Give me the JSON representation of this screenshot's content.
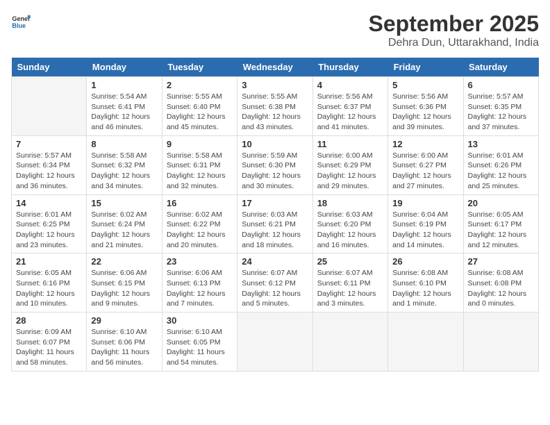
{
  "header": {
    "logo_general": "General",
    "logo_blue": "Blue",
    "month_year": "September 2025",
    "location": "Dehra Dun, Uttarakhand, India"
  },
  "days_of_week": [
    "Sunday",
    "Monday",
    "Tuesday",
    "Wednesday",
    "Thursday",
    "Friday",
    "Saturday"
  ],
  "weeks": [
    [
      {
        "day": "",
        "info": ""
      },
      {
        "day": "1",
        "info": "Sunrise: 5:54 AM\nSunset: 6:41 PM\nDaylight: 12 hours\nand 46 minutes."
      },
      {
        "day": "2",
        "info": "Sunrise: 5:55 AM\nSunset: 6:40 PM\nDaylight: 12 hours\nand 45 minutes."
      },
      {
        "day": "3",
        "info": "Sunrise: 5:55 AM\nSunset: 6:38 PM\nDaylight: 12 hours\nand 43 minutes."
      },
      {
        "day": "4",
        "info": "Sunrise: 5:56 AM\nSunset: 6:37 PM\nDaylight: 12 hours\nand 41 minutes."
      },
      {
        "day": "5",
        "info": "Sunrise: 5:56 AM\nSunset: 6:36 PM\nDaylight: 12 hours\nand 39 minutes."
      },
      {
        "day": "6",
        "info": "Sunrise: 5:57 AM\nSunset: 6:35 PM\nDaylight: 12 hours\nand 37 minutes."
      }
    ],
    [
      {
        "day": "7",
        "info": "Sunrise: 5:57 AM\nSunset: 6:34 PM\nDaylight: 12 hours\nand 36 minutes."
      },
      {
        "day": "8",
        "info": "Sunrise: 5:58 AM\nSunset: 6:32 PM\nDaylight: 12 hours\nand 34 minutes."
      },
      {
        "day": "9",
        "info": "Sunrise: 5:58 AM\nSunset: 6:31 PM\nDaylight: 12 hours\nand 32 minutes."
      },
      {
        "day": "10",
        "info": "Sunrise: 5:59 AM\nSunset: 6:30 PM\nDaylight: 12 hours\nand 30 minutes."
      },
      {
        "day": "11",
        "info": "Sunrise: 6:00 AM\nSunset: 6:29 PM\nDaylight: 12 hours\nand 29 minutes."
      },
      {
        "day": "12",
        "info": "Sunrise: 6:00 AM\nSunset: 6:27 PM\nDaylight: 12 hours\nand 27 minutes."
      },
      {
        "day": "13",
        "info": "Sunrise: 6:01 AM\nSunset: 6:26 PM\nDaylight: 12 hours\nand 25 minutes."
      }
    ],
    [
      {
        "day": "14",
        "info": "Sunrise: 6:01 AM\nSunset: 6:25 PM\nDaylight: 12 hours\nand 23 minutes."
      },
      {
        "day": "15",
        "info": "Sunrise: 6:02 AM\nSunset: 6:24 PM\nDaylight: 12 hours\nand 21 minutes."
      },
      {
        "day": "16",
        "info": "Sunrise: 6:02 AM\nSunset: 6:22 PM\nDaylight: 12 hours\nand 20 minutes."
      },
      {
        "day": "17",
        "info": "Sunrise: 6:03 AM\nSunset: 6:21 PM\nDaylight: 12 hours\nand 18 minutes."
      },
      {
        "day": "18",
        "info": "Sunrise: 6:03 AM\nSunset: 6:20 PM\nDaylight: 12 hours\nand 16 minutes."
      },
      {
        "day": "19",
        "info": "Sunrise: 6:04 AM\nSunset: 6:19 PM\nDaylight: 12 hours\nand 14 minutes."
      },
      {
        "day": "20",
        "info": "Sunrise: 6:05 AM\nSunset: 6:17 PM\nDaylight: 12 hours\nand 12 minutes."
      }
    ],
    [
      {
        "day": "21",
        "info": "Sunrise: 6:05 AM\nSunset: 6:16 PM\nDaylight: 12 hours\nand 10 minutes."
      },
      {
        "day": "22",
        "info": "Sunrise: 6:06 AM\nSunset: 6:15 PM\nDaylight: 12 hours\nand 9 minutes."
      },
      {
        "day": "23",
        "info": "Sunrise: 6:06 AM\nSunset: 6:13 PM\nDaylight: 12 hours\nand 7 minutes."
      },
      {
        "day": "24",
        "info": "Sunrise: 6:07 AM\nSunset: 6:12 PM\nDaylight: 12 hours\nand 5 minutes."
      },
      {
        "day": "25",
        "info": "Sunrise: 6:07 AM\nSunset: 6:11 PM\nDaylight: 12 hours\nand 3 minutes."
      },
      {
        "day": "26",
        "info": "Sunrise: 6:08 AM\nSunset: 6:10 PM\nDaylight: 12 hours\nand 1 minute."
      },
      {
        "day": "27",
        "info": "Sunrise: 6:08 AM\nSunset: 6:08 PM\nDaylight: 12 hours\nand 0 minutes."
      }
    ],
    [
      {
        "day": "28",
        "info": "Sunrise: 6:09 AM\nSunset: 6:07 PM\nDaylight: 11 hours\nand 58 minutes."
      },
      {
        "day": "29",
        "info": "Sunrise: 6:10 AM\nSunset: 6:06 PM\nDaylight: 11 hours\nand 56 minutes."
      },
      {
        "day": "30",
        "info": "Sunrise: 6:10 AM\nSunset: 6:05 PM\nDaylight: 11 hours\nand 54 minutes."
      },
      {
        "day": "",
        "info": ""
      },
      {
        "day": "",
        "info": ""
      },
      {
        "day": "",
        "info": ""
      },
      {
        "day": "",
        "info": ""
      }
    ]
  ]
}
